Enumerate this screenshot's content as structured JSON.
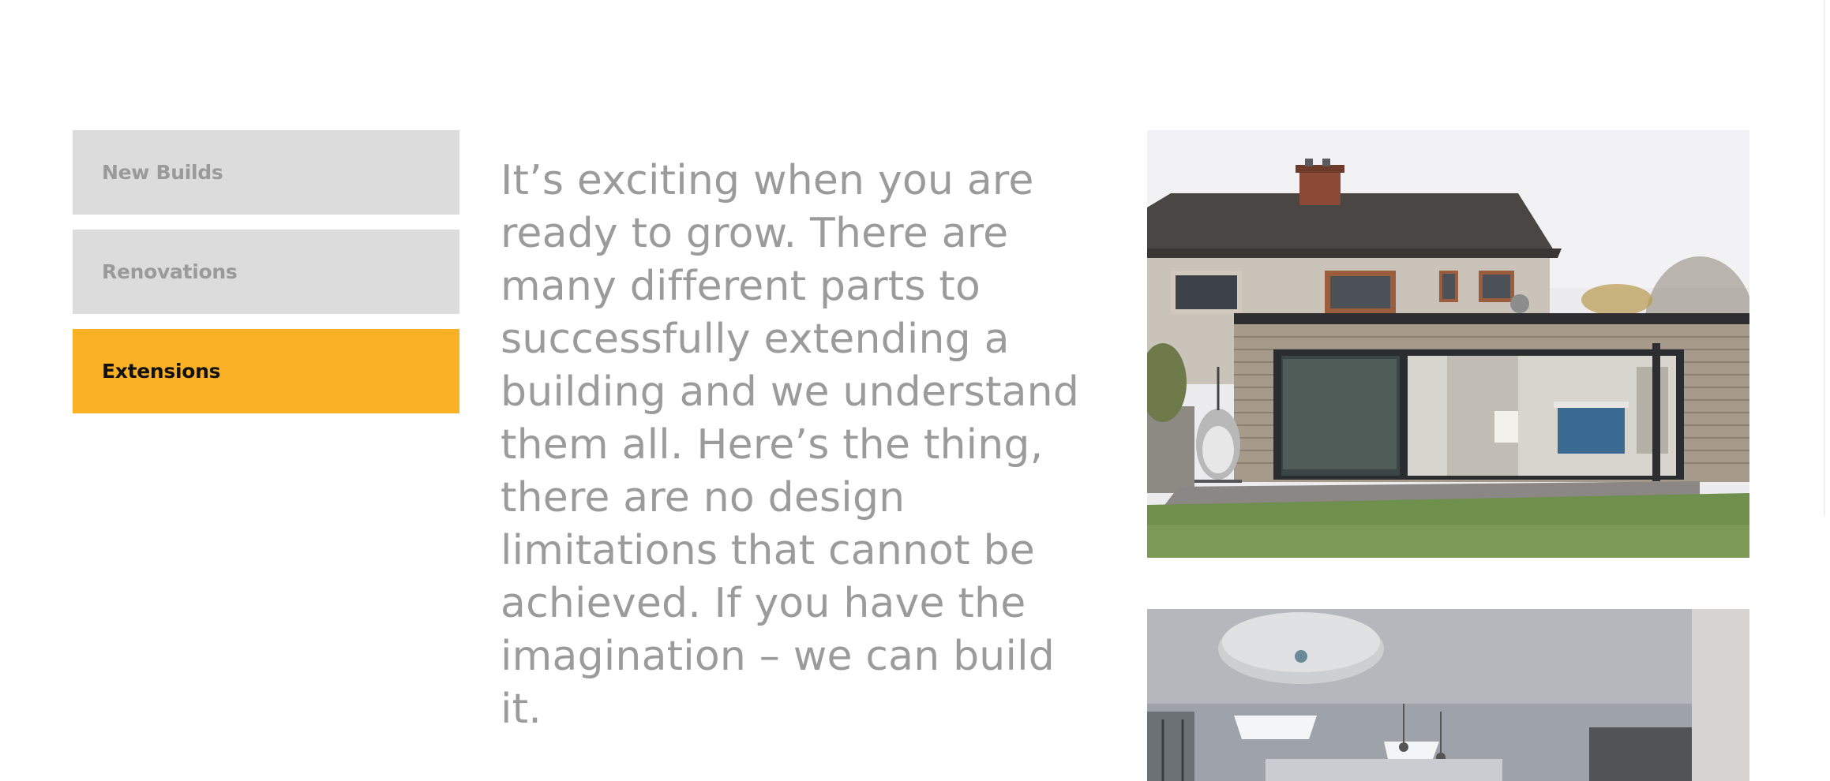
{
  "tabs": [
    {
      "label": "New Builds",
      "active": false
    },
    {
      "label": "Renovations",
      "active": false
    },
    {
      "label": "Extensions",
      "active": true
    }
  ],
  "intro_text": "It’s exciting when you are ready to grow.  There are many different parts to successfully extending a building and we understand them all. Here’s the thing, there are no design limitations that cannot be achieved. If you have the imagination – we can build it.",
  "colors": {
    "accent": "#fab126",
    "tab_inactive_bg": "#dcdcdc",
    "tab_inactive_text": "#9a9a9a",
    "tab_active_text": "#111111",
    "body_text": "#9b9b9b"
  },
  "images": {
    "exterior": "house-extension-exterior-photo",
    "interior": "kitchen-interior-photo"
  }
}
